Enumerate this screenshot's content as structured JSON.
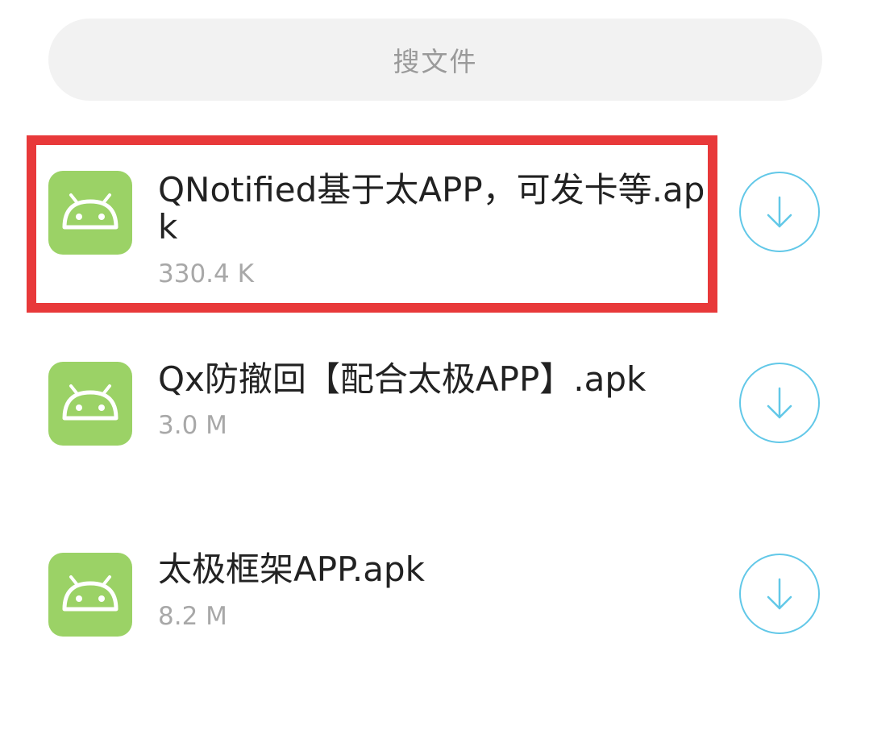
{
  "search": {
    "placeholder": "搜文件"
  },
  "files": [
    {
      "name": "QNotified基于太APP，可发卡等.apk",
      "size": "330.4 K",
      "icon": "android-icon",
      "action_icon": "download-icon"
    },
    {
      "name": "Qx防撤回【配合太极APP】.apk",
      "size": "3.0 M",
      "icon": "android-icon",
      "action_icon": "download-icon"
    },
    {
      "name": "太极框架APP.apk",
      "size": "8.2 M",
      "icon": "android-icon",
      "action_icon": "download-icon"
    }
  ],
  "colors": {
    "icon_bg": "#9bd266",
    "highlight": "#e8393a",
    "download_accent": "#62c8e8"
  }
}
